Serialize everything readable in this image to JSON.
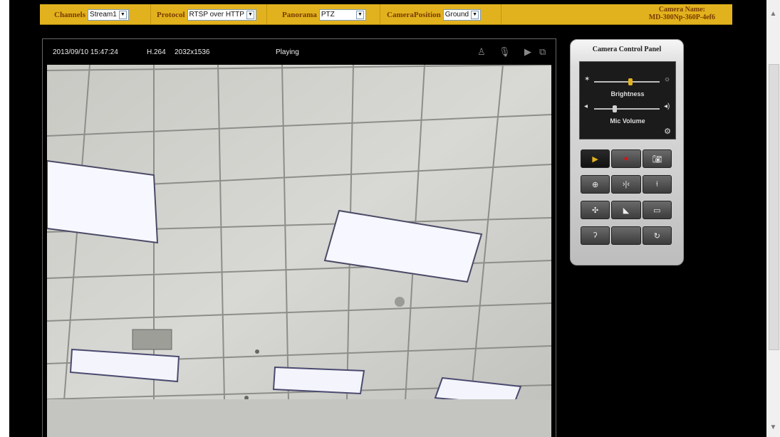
{
  "toolbar": {
    "channel_label": "Channels",
    "channel_value": "Stream1",
    "protocol_label": "Protocol",
    "protocol_value": "RTSP over HTTP",
    "panorama_label": "Panorama",
    "panorama_value": "PTZ",
    "position_label": "CameraPosition",
    "position_value": "Ground",
    "camera_name_label": "Camera Name:",
    "camera_name_value": "MD-300Np-360P-4ef6"
  },
  "video": {
    "timestamp": "2013/09/10 15:47:24",
    "codec": "H.264",
    "resolution": "2032x1536",
    "state": "Playing"
  },
  "control_panel": {
    "title": "Camera Control Panel",
    "brightness_label": "Brightness",
    "brightness_level": 0.55,
    "mic_label": "Mic Volume",
    "mic_level": 0.32,
    "accent_color": "#e2b21e",
    "record_color": "#e01010"
  },
  "icons": [
    "person-icon",
    "microphone-icon",
    "play-icon",
    "fullscreen-icon",
    "sun-low-icon",
    "sun-high-icon",
    "speaker-low-icon",
    "speaker-high-icon",
    "gear-icon",
    "play-icon",
    "record-icon",
    "camera-icon",
    "zoom-in-icon",
    "fit-horizontal-icon",
    "fit-vertical-icon",
    "move-icon",
    "corner-icon",
    "rectangle-icon",
    "ear-icon",
    "rotate-icon"
  ]
}
